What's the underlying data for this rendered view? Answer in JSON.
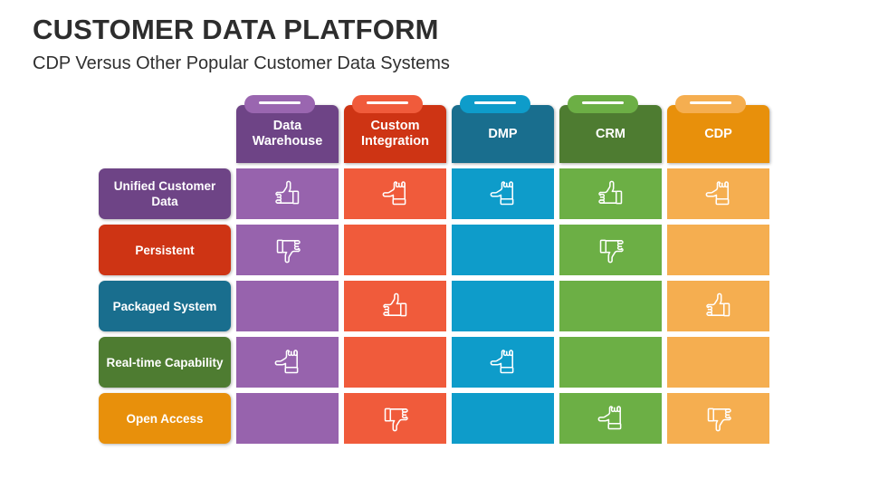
{
  "header": {
    "title": "CUSTOMER DATA PLATFORM",
    "subtitle": "CDP Versus Other Popular Customer Data Systems"
  },
  "palette": {
    "purple_dark": "#6E4486",
    "purple_light": "#9763AD",
    "purple_tab": "#9A66B0",
    "red_dark": "#CE3414",
    "red_light": "#F05B3B",
    "red_tab": "#F05B3B",
    "blue_dark": "#196E8E",
    "blue_light": "#0E9CCA",
    "blue_tab": "#0E9CCA",
    "green_dark": "#4E7C31",
    "green_light": "#6CAF45",
    "green_tab": "#6CAF45",
    "orange_dark": "#E8900B",
    "orange_light": "#F5AE50",
    "orange_tab": "#F5AE50",
    "title_color": "#2d2d2d",
    "background": "#ffffff"
  },
  "matrix": {
    "columns": [
      {
        "label": "Data Warehouse",
        "key": "data-warehouse",
        "head_color": "#6E4486",
        "tab_color": "#9A66B0",
        "cell_color": "#9763AD"
      },
      {
        "label": "Custom Integration",
        "key": "custom-integration",
        "head_color": "#CE3414",
        "tab_color": "#F05B3B",
        "cell_color": "#F05B3B"
      },
      {
        "label": "DMP",
        "key": "dmp",
        "head_color": "#196E8E",
        "tab_color": "#0E9CCA",
        "cell_color": "#0E9CCA"
      },
      {
        "label": "CRM",
        "key": "crm",
        "head_color": "#4E7C31",
        "tab_color": "#6CAF45",
        "cell_color": "#6CAF45"
      },
      {
        "label": "CDP",
        "key": "cdp",
        "head_color": "#E8900B",
        "tab_color": "#F5AE50",
        "cell_color": "#F5AE50"
      }
    ],
    "rows": [
      {
        "label": "Unified Customer Data",
        "key": "unified-customer-data",
        "head_color": "#6E4486",
        "cells": [
          "thumb-up-icon",
          "thumb-side-icon",
          "thumb-side-icon",
          "thumb-up-icon",
          "thumb-side-icon"
        ]
      },
      {
        "label": "Persistent",
        "key": "persistent",
        "head_color": "#CE3414",
        "cells": [
          "thumb-down-icon",
          "",
          "",
          "thumb-down-icon",
          ""
        ]
      },
      {
        "label": "Packaged System",
        "key": "packaged-system",
        "head_color": "#196E8E",
        "cells": [
          "",
          "thumb-up-icon",
          "",
          "",
          "thumb-up-icon"
        ]
      },
      {
        "label": "Real-time Capability",
        "key": "real-time-capability",
        "head_color": "#4E7C31",
        "cells": [
          "thumb-side-icon",
          "",
          "thumb-side-icon",
          "",
          ""
        ]
      },
      {
        "label": "Open Access",
        "key": "open-access",
        "head_color": "#E8900B",
        "cells": [
          "",
          "thumb-down-icon",
          "",
          "thumb-side-icon",
          "thumb-down-icon"
        ]
      }
    ]
  }
}
